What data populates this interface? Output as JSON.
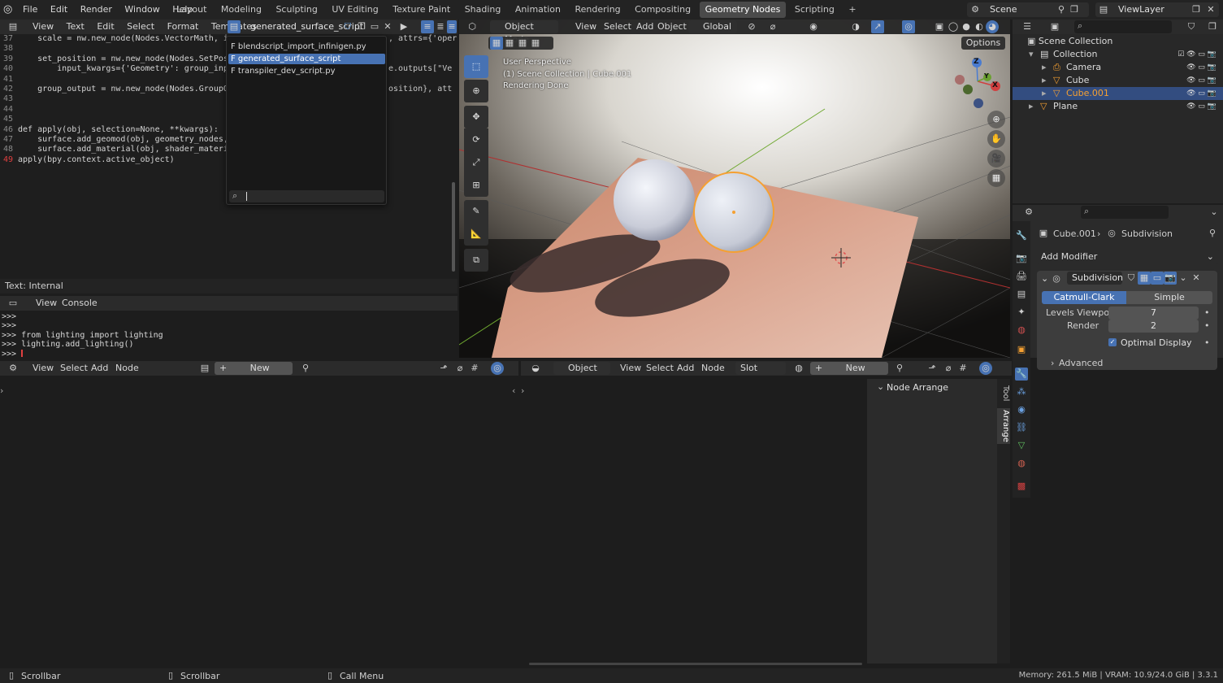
{
  "topbar": {
    "menus": [
      "File",
      "Edit",
      "Render",
      "Window",
      "Help"
    ],
    "workspaces": [
      "Layout",
      "Modeling",
      "Sculpting",
      "UV Editing",
      "Texture Paint",
      "Shading",
      "Animation",
      "Rendering",
      "Compositing",
      "Geometry Nodes",
      "Scripting"
    ],
    "active_workspace": "Geometry Nodes",
    "add_workspace": "+",
    "scene_name": "Scene",
    "view_layer": "ViewLayer"
  },
  "text_editor": {
    "menus": [
      "View",
      "Text",
      "Edit",
      "Select",
      "Format",
      "Templates"
    ],
    "file_name": "generated_surface_script",
    "status": "Text: Internal",
    "lines": [
      {
        "n": "37",
        "code": "    scale = nw.new_node(Nodes.VectorMath, inp"
      },
      {
        "n": "38",
        "code": ""
      },
      {
        "n": "39",
        "code": "    set_position = nw.new_node(Nodes.SetPosit"
      },
      {
        "n": "40",
        "code": "        input_kwargs={'Geometry': group_input"
      },
      {
        "n": "41",
        "code": ""
      },
      {
        "n": "42",
        "code": "    group_output = nw.new_node(Nodes.GroupOut"
      },
      {
        "n": "43",
        "code": ""
      },
      {
        "n": "44",
        "code": ""
      },
      {
        "n": "45",
        "code": ""
      },
      {
        "n": "46",
        "code": "def apply(obj, selection=None, **kwargs):"
      },
      {
        "n": "47",
        "code": "    surface.add_geomod(obj, geometry_nodes, s"
      },
      {
        "n": "48",
        "code": "    surface.add_material(obj, shader_material"
      },
      {
        "n": "49",
        "code": "apply(bpy.context.active_object)"
      }
    ],
    "right_fragments": [
      ", attrs={'oper",
      "e.outputs[\"Ve",
      "osition}, att"
    ],
    "dropdown_files": [
      "F blendscript_import_infinigen.py",
      "F generated_surface_script",
      "F transpiler_dev_script.py"
    ],
    "dropdown_selected": "F generated_surface_script"
  },
  "console": {
    "menus": [
      "View",
      "Console"
    ],
    "lines": [
      ">>>",
      ">>>",
      ">>> from lighting import lighting",
      ">>> lighting.add_lighting()",
      ">>> "
    ]
  },
  "viewport": {
    "mode": "Object Mode",
    "menus": [
      "View",
      "Select",
      "Add",
      "Object"
    ],
    "transform_orientation": "Global",
    "options": "Options",
    "info": [
      "User Perspective",
      "(1) Scene Collection | Cube.001",
      "Rendering Done"
    ],
    "axes": {
      "x": "X",
      "y": "Y",
      "z": "Z"
    }
  },
  "outliner": {
    "root": "Scene Collection",
    "items": [
      {
        "name": "Collection",
        "indent": 1,
        "icon": "collection-icon",
        "selected": false
      },
      {
        "name": "Camera",
        "indent": 2,
        "icon": "camera-icon",
        "selected": false
      },
      {
        "name": "Cube",
        "indent": 2,
        "icon": "mesh-icon",
        "selected": false
      },
      {
        "name": "Cube.001",
        "indent": 2,
        "icon": "mesh-icon",
        "selected": true
      },
      {
        "name": "Plane",
        "indent": 1,
        "icon": "mesh-icon",
        "selected": false
      }
    ]
  },
  "properties": {
    "breadcrumb_object": "Cube.001",
    "breadcrumb_modifier": "Subdivision",
    "add_modifier": "Add Modifier",
    "modifier_name": "Subdivision",
    "algo_options": [
      "Catmull-Clark",
      "Simple"
    ],
    "algo_selected": "Catmull-Clark",
    "levels_viewport_label": "Levels Viewport",
    "levels_viewport": "7",
    "render_label": "Render",
    "render": "2",
    "optimal_display": "Optimal Display",
    "advanced": "Advanced"
  },
  "node_editor_left": {
    "menus": [
      "View",
      "Select",
      "Add",
      "Node"
    ],
    "new_label": "New"
  },
  "node_editor_right": {
    "mode": "Object",
    "menus": [
      "View",
      "Select",
      "Add",
      "Node"
    ],
    "slot": "Slot",
    "new_label": "New",
    "panel_title": "Node Arrange",
    "side_tabs": [
      "Tool",
      "Arrange"
    ]
  },
  "statusbar": {
    "left": [
      "Scrollbar",
      "Scrollbar",
      "Call Menu"
    ],
    "right": "Memory: 261.5 MiB | VRAM: 10.9/24.0 GiB | 3.3.1"
  },
  "colors": {
    "accent": "#4772b3",
    "selection_orange": "#f5a032",
    "active_tab": "#4a4a4a"
  }
}
